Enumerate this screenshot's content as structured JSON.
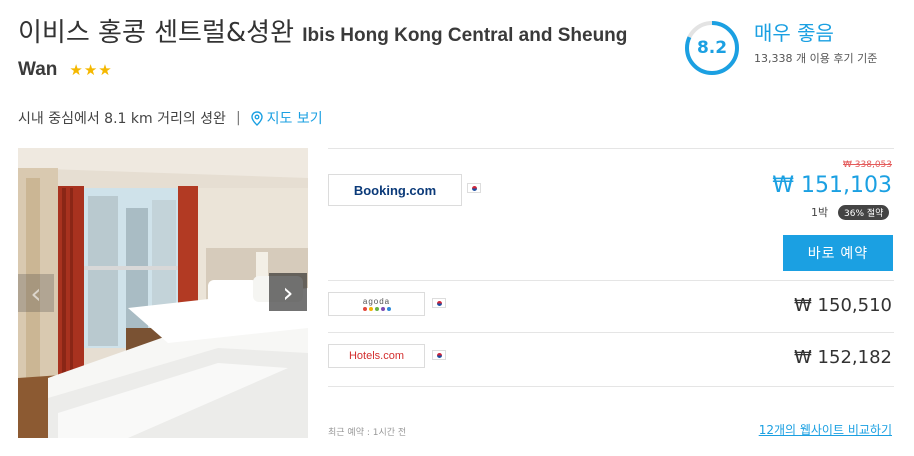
{
  "hotel": {
    "name_ko": "이비스 홍콩 센트럴&셩완",
    "name_en_part1": "Ibis Hong Kong Central and Sheung",
    "name_en_part2": "Wan",
    "stars": "★★★",
    "star_count": 3
  },
  "rating": {
    "score": "8.2",
    "score_fraction": 0.82,
    "label": "매우 좋음",
    "reviews": "13,338 개 이용 후기 기준"
  },
  "location": {
    "distance": "시내 중심에서 8.1 km 거리의 셩완",
    "separator": "|",
    "map_link": "지도 보기"
  },
  "offers": [
    {
      "provider": "Booking.com",
      "old_price": "₩ 338,053",
      "price": "₩ 151,103",
      "per_night": "1박",
      "discount": "36% 절약",
      "book_label": "바로 예약"
    },
    {
      "provider": "agoda",
      "price": "₩ 150,510"
    },
    {
      "provider": "Hotels.com",
      "price": "₩ 152,182"
    }
  ],
  "footer": {
    "recent_booking": "최근 예약 : 1시간 전",
    "compare_link": "12개의 웹사이트 비교하기"
  },
  "colors": {
    "accent": "#1ba0e2",
    "star": "#f5b800",
    "old_price": "#e45b5b"
  }
}
